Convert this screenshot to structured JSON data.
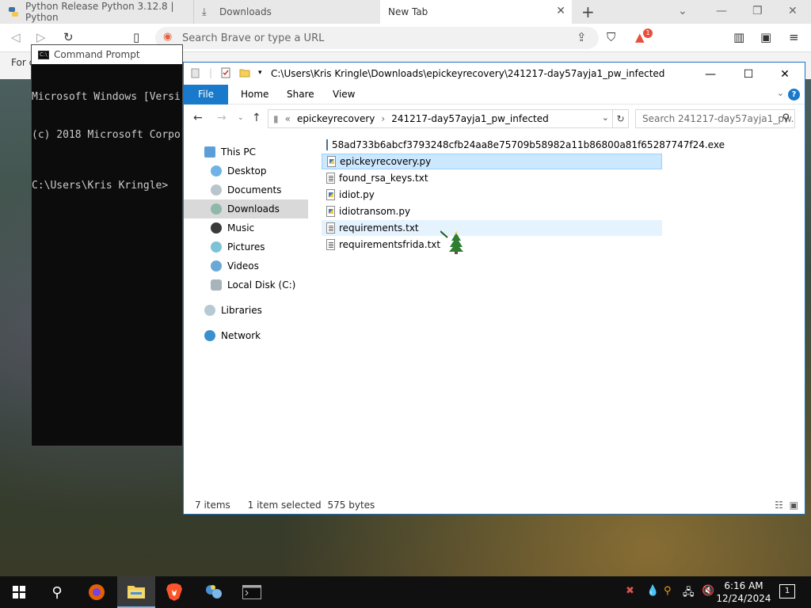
{
  "browser": {
    "tabs": [
      {
        "title": "Python Release Python 3.12.8 | Python"
      },
      {
        "title": "Downloads"
      },
      {
        "title": "New Tab"
      }
    ],
    "url_placeholder": "Search Brave or type a URL",
    "bookmark_text": "For c",
    "shields_badge": "1"
  },
  "cmd": {
    "title": "Command Prompt",
    "lines": [
      "Microsoft Windows [Versi",
      "(c) 2018 Microsoft Corpo"
    ],
    "prompt": "C:\\Users\\Kris Kringle>"
  },
  "explorer": {
    "title_path": "C:\\Users\\Kris Kringle\\Downloads\\epickeyrecovery\\241217-day57ayja1_pw_infected",
    "ribbon_tabs": [
      "File",
      "Home",
      "Share",
      "View"
    ],
    "breadcrumb": {
      "prefix": "«",
      "items": [
        "epickeyrecovery",
        "241217-day57ayja1_pw_infected"
      ]
    },
    "search_placeholder": "Search 241217-day57ayja1_pw...",
    "nav": [
      {
        "label": "This PC",
        "icon": "computer-icon"
      },
      {
        "label": "Desktop",
        "icon": "desktop-icon"
      },
      {
        "label": "Documents",
        "icon": "documents-icon"
      },
      {
        "label": "Downloads",
        "icon": "downloads-icon"
      },
      {
        "label": "Music",
        "icon": "music-icon"
      },
      {
        "label": "Pictures",
        "icon": "pictures-icon"
      },
      {
        "label": "Videos",
        "icon": "videos-icon"
      },
      {
        "label": "Local Disk (C:)",
        "icon": "drive-icon"
      },
      {
        "label": "Libraries",
        "icon": "libraries-icon"
      },
      {
        "label": "Network",
        "icon": "network-icon"
      }
    ],
    "files": [
      {
        "name": "58ad733b6abcf3793248cfb24aa8e75709b58982a11b86800a81f65287747f24.exe",
        "type": "exe"
      },
      {
        "name": "epickeyrecovery.py",
        "type": "py"
      },
      {
        "name": "found_rsa_keys.txt",
        "type": "txt"
      },
      {
        "name": "idiot.py",
        "type": "py"
      },
      {
        "name": "idiotransom.py",
        "type": "py"
      },
      {
        "name": "requirements.txt",
        "type": "txt"
      },
      {
        "name": "requirementsfrida.txt",
        "type": "txt"
      }
    ],
    "selected_file": "epickeyrecovery.py",
    "status": {
      "count": "7 items",
      "selection": "1 item selected",
      "size": "575 bytes"
    }
  },
  "taskbar": {
    "time": "6:16 AM",
    "date": "12/24/2024",
    "notification_count": "1"
  }
}
